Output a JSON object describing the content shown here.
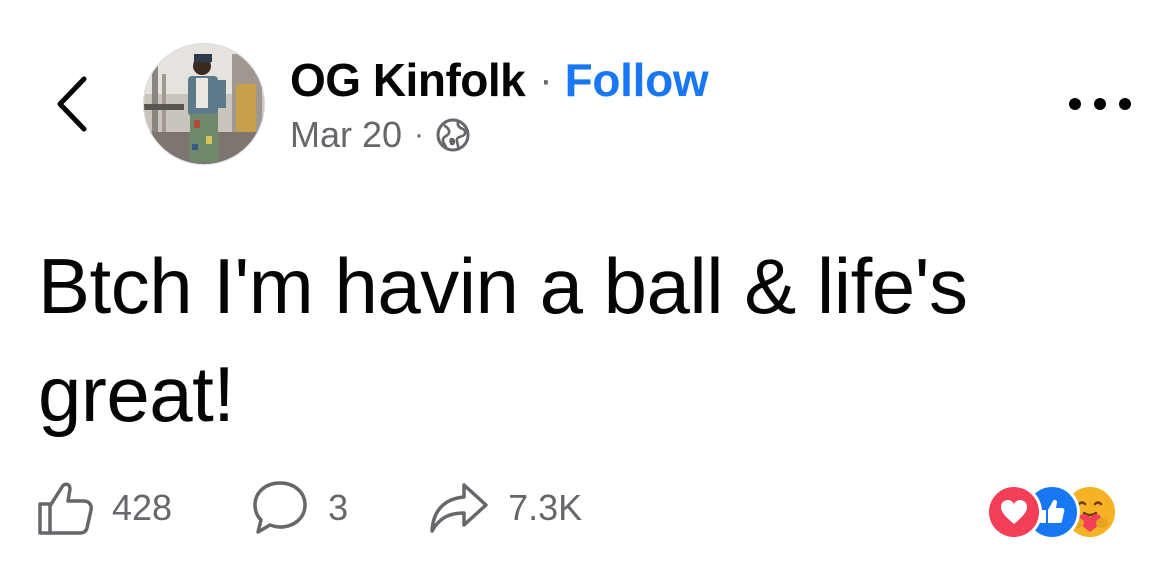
{
  "header": {
    "author_name": "OG Kinfolk",
    "separator": "·",
    "follow_label": "Follow",
    "date": "Mar 20",
    "meta_separator": "·",
    "privacy_icon": "globe-icon",
    "back_icon": "chevron-left-icon",
    "more_icon": "more-horizontal-icon"
  },
  "post": {
    "text": "Btch I'm havin a ball & life's great!"
  },
  "actions": {
    "like_count": "428",
    "comment_count": "3",
    "share_count": "7.3K"
  },
  "reactions": {
    "types": [
      "love",
      "like",
      "care"
    ]
  },
  "colors": {
    "accent": "#1877f2",
    "text_primary": "#050505",
    "text_secondary": "#65676b",
    "love": "#f33e58",
    "care": "#f7b125"
  }
}
